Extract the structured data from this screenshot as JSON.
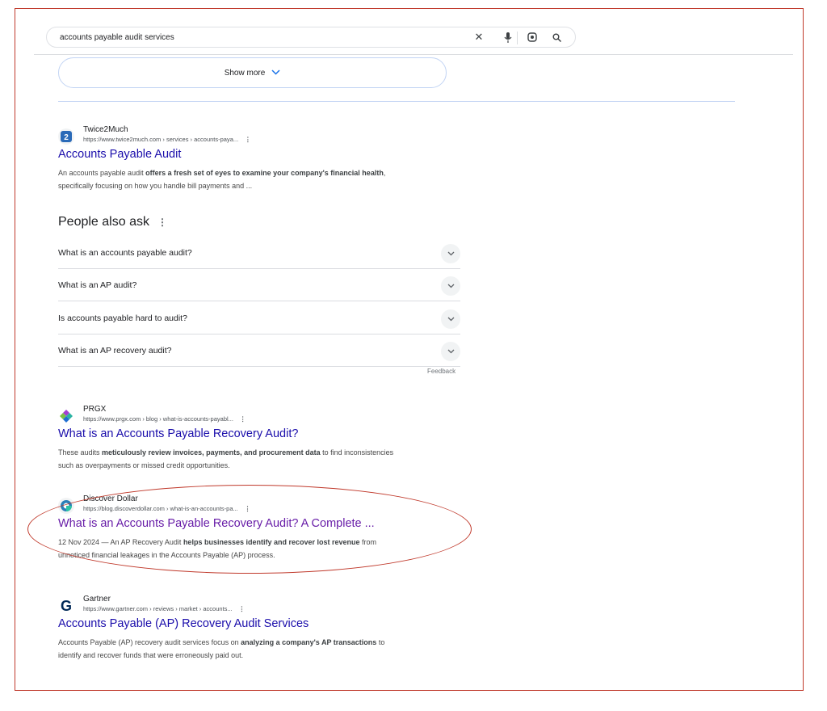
{
  "search": {
    "query": "accounts payable audit services",
    "icons": [
      "close-icon",
      "microphone-icon",
      "lens-icon",
      "search-icon"
    ]
  },
  "show_more": {
    "label": "Show more"
  },
  "results": [
    {
      "site": "Twice2Much",
      "url": "https://www.twice2much.com › services › accounts-paya...",
      "title": "Accounts Payable Audit",
      "snippet_lines": [
        [
          "An accounts payable audit ",
          "offers a fresh set of eyes to examine your company's financial health",
          ","
        ],
        [
          "specifically focusing on how you handle bill payments and ...",
          "",
          ""
        ]
      ]
    },
    {
      "site": "PRGX",
      "url": "https://www.prgx.com › blog › what-is-accounts-payabl...",
      "title": "What is an Accounts Payable Recovery Audit?",
      "snippet_lines": [
        [
          "These audits ",
          "meticulously review invoices, payments, and procurement data",
          " to find inconsistencies"
        ],
        [
          "such as overpayments or missed credit opportunities.",
          "",
          ""
        ]
      ]
    },
    {
      "site": "Discover Dollar",
      "url": "https://blog.discoverdollar.com › what-is-an-accounts-pa...",
      "title": "What is an Accounts Payable Recovery Audit? A Complete ...",
      "snippet_lines": [
        [
          "12 Nov 2024 — An AP Recovery Audit ",
          "helps businesses identify and recover lost revenue",
          " from"
        ],
        [
          "unnoticed financial leakages in the Accounts Payable (AP) process.",
          "",
          ""
        ]
      ]
    },
    {
      "site": "Gartner",
      "url": "https://www.gartner.com › reviews › market › accounts...",
      "title": "Accounts Payable (AP) Recovery Audit Services",
      "snippet_lines": [
        [
          "Accounts Payable (AP) recovery audit services focus on ",
          "analyzing a company's AP transactions",
          " to"
        ],
        [
          "identify and recover funds that were erroneously paid out.",
          "",
          ""
        ]
      ]
    }
  ],
  "people_also_ask": {
    "heading": "People also ask",
    "questions": [
      "What is an accounts payable audit?",
      "What is an AP audit?",
      "Is accounts payable hard to audit?",
      "What is an AP recovery audit?"
    ],
    "feedback": "Feedback"
  },
  "favicons": {
    "gartner": "G"
  },
  "colors": {
    "link": "#1a0dab",
    "visited": "#681da8",
    "highlight": "#c0392b"
  }
}
